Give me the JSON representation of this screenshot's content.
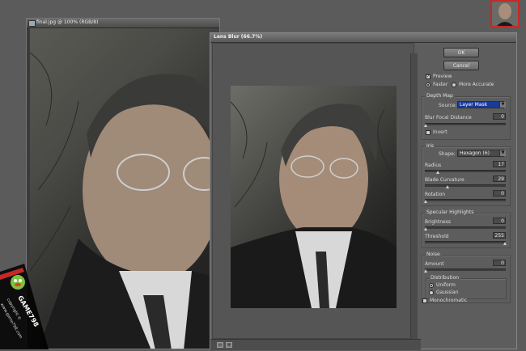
{
  "background_window": {
    "title": "final.jpg @ 100% (RGB/8)"
  },
  "dialog": {
    "title": "Lens Blur (66.7%)",
    "zoom_out": "−",
    "zoom_in": "+",
    "ok_label": "OK",
    "cancel_label": "Cancel",
    "preview_label": "Preview",
    "faster_label": "Faster",
    "more_accurate_label": "More Accurate",
    "depth_map": {
      "legend": "Depth Map",
      "source_label": "Source:",
      "source_value": "Layer Mask",
      "focal_label": "Blur Focal Distance",
      "focal_value": "0",
      "invert_label": "Invert"
    },
    "iris": {
      "legend": "Iris",
      "shape_label": "Shape:",
      "shape_value": "Hexagon (6)",
      "radius_label": "Radius",
      "radius_value": "17",
      "curvature_label": "Blade Curvature",
      "curvature_value": "29",
      "rotation_label": "Rotation",
      "rotation_value": "0"
    },
    "specular": {
      "legend": "Specular Highlights",
      "brightness_label": "Brightness",
      "brightness_value": "0",
      "threshold_label": "Threshold",
      "threshold_value": "255"
    },
    "noise": {
      "legend": "Noise",
      "amount_label": "Amount",
      "amount_value": "0",
      "distribution_legend": "Distribution",
      "uniform_label": "Uniform",
      "gaussian_label": "Gaussian",
      "mono_label": "Monochromatic"
    }
  },
  "watermark": {
    "brand": "GAME798",
    "line1": "copyright ©",
    "line2": "www.game798.com"
  }
}
